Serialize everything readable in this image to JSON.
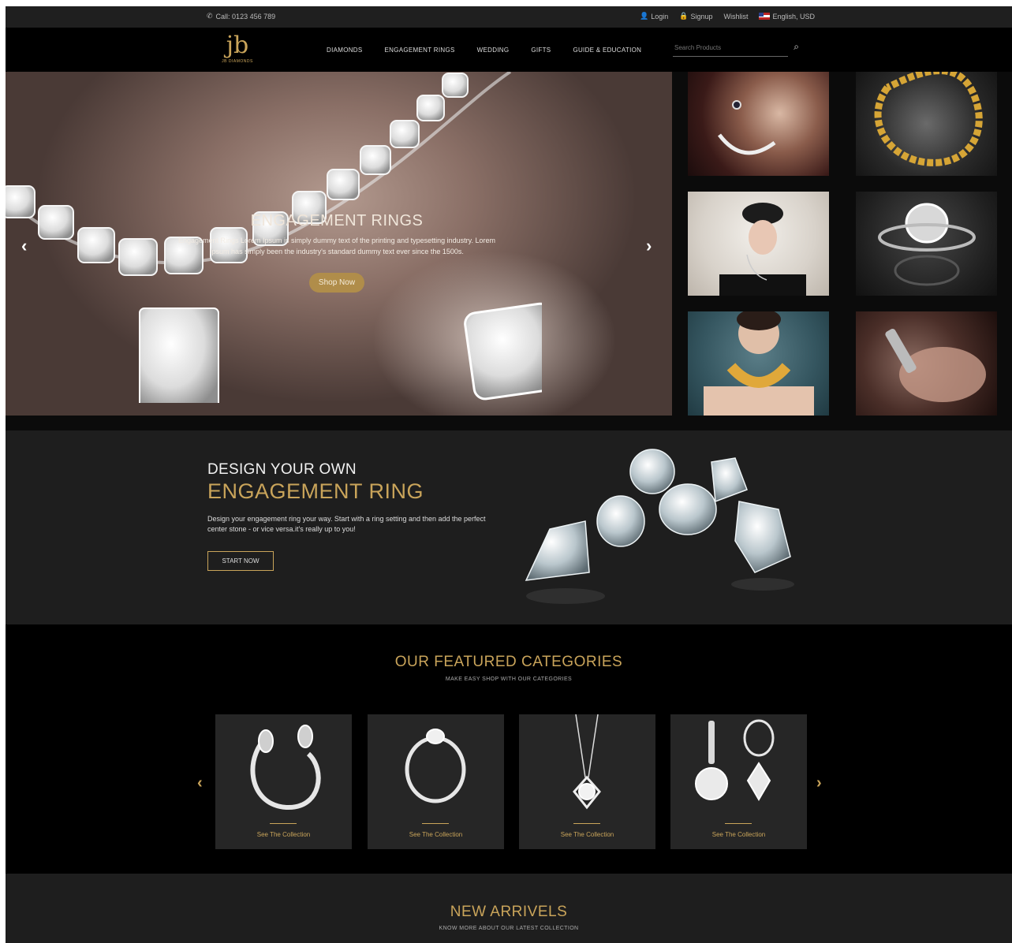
{
  "topbar": {
    "call": "Call: 0123 456 789",
    "login": "Login",
    "signup": "Signup",
    "wishlist": "Wishlist",
    "language": "English, USD"
  },
  "header": {
    "logo_mark": "jb",
    "logo_name": "JB DIAMONDS",
    "nav": [
      "DIAMONDS",
      "ENGAGEMENT RINGS",
      "WEDDING",
      "GIFTS",
      "GUIDE & EDUCATION"
    ],
    "search_placeholder": "Search Products"
  },
  "hero": {
    "title": "ENGAGEMENT RINGS",
    "text": "Engagement Rings Lorem Ipsum is simply dummy text of the printing and typesetting industry. Lorem Ipsum has simply been the industry's standard dummy text ever since the 1500s.",
    "button": "Shop Now"
  },
  "design": {
    "line1": "DESIGN YOUR OWN",
    "line2": "ENGAGEMENT RING",
    "text": "Design your engagement ring your way. Start with a ring setting and then add the perfect center stone - or vice versa.it's really up to you!",
    "button": "START NOW"
  },
  "categories": {
    "title": "OUR FEATURED CATEGORIES",
    "subtitle": "MAKE EASY SHOP WITH OUR CATEGORIES",
    "cards": [
      {
        "label": "See The Collection"
      },
      {
        "label": "See The Collection"
      },
      {
        "label": "See The Collection"
      },
      {
        "label": "See The Collection"
      }
    ]
  },
  "arrivals": {
    "title": "NEW ARRIVELS",
    "subtitle": "KNOW MORE ABOUT OUR LATEST COLLECTION"
  },
  "colors": {
    "accent_gold": "#c9a45a",
    "background": "#0b0b0b",
    "section_dark": "#1e1e1e"
  }
}
